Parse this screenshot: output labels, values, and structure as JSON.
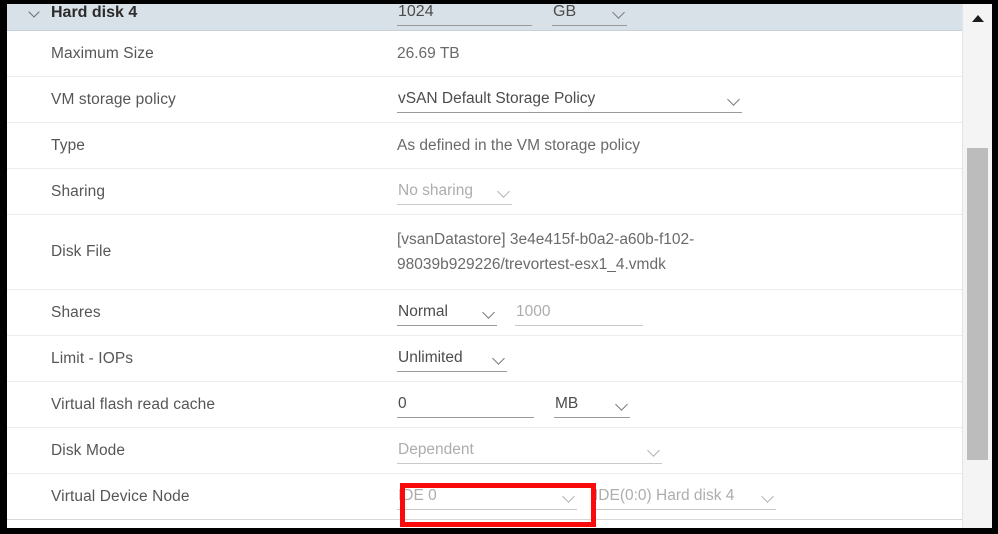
{
  "header": {
    "title": "Hard disk 4",
    "collapse_icon": "chevron-down-icon",
    "size_value": "1024",
    "size_unit": "GB",
    "size_unit_icon": "chevron-down-icon"
  },
  "rows": [
    {
      "label": "Maximum Size",
      "type": "text",
      "value": "26.69 TB"
    },
    {
      "label": "VM storage policy",
      "type": "select",
      "value": "vSAN Default Storage Policy",
      "icon": "chevron-down-icon"
    },
    {
      "label": "Type",
      "type": "text",
      "value": "As defined in the VM storage policy"
    },
    {
      "label": "Sharing",
      "type": "select-disabled",
      "value": "No sharing",
      "icon": "chevron-down-icon"
    },
    {
      "label": "Disk File",
      "type": "multiline",
      "value": "[vsanDatastore] 3e4e415f-b0a2-a60b-f102-98039b929226/trevortest-esx1_4.vmdk"
    },
    {
      "label": "Shares",
      "type": "select-plus-input",
      "value": "Normal",
      "icon": "chevron-down-icon",
      "secondary_value": "1000"
    },
    {
      "label": "Limit - IOPs",
      "type": "select",
      "value": "Unlimited",
      "icon": "chevron-down-icon"
    },
    {
      "label": "Virtual flash read cache",
      "type": "input-plus-select",
      "value": "0",
      "secondary_value": "MB",
      "icon": "chevron-down-icon"
    },
    {
      "label": "Disk Mode",
      "type": "select-disabled",
      "value": "Dependent",
      "icon": "chevron-down-icon"
    },
    {
      "label": "Virtual Device Node",
      "type": "two-selects",
      "value": "IDE 0",
      "icon": "chevron-down-icon",
      "secondary_value": "IDE(0:0) Hard disk 4",
      "secondary_icon": "chevron-down-icon"
    }
  ],
  "annotation": {
    "highlight_color": "#fa0a0a",
    "target": "virtual-device-node-controller-select"
  },
  "scrollbar": {
    "up_arrow_icon": "triangle-up-icon",
    "thumb_top_pct": 27,
    "thumb_height_pct": 60
  }
}
